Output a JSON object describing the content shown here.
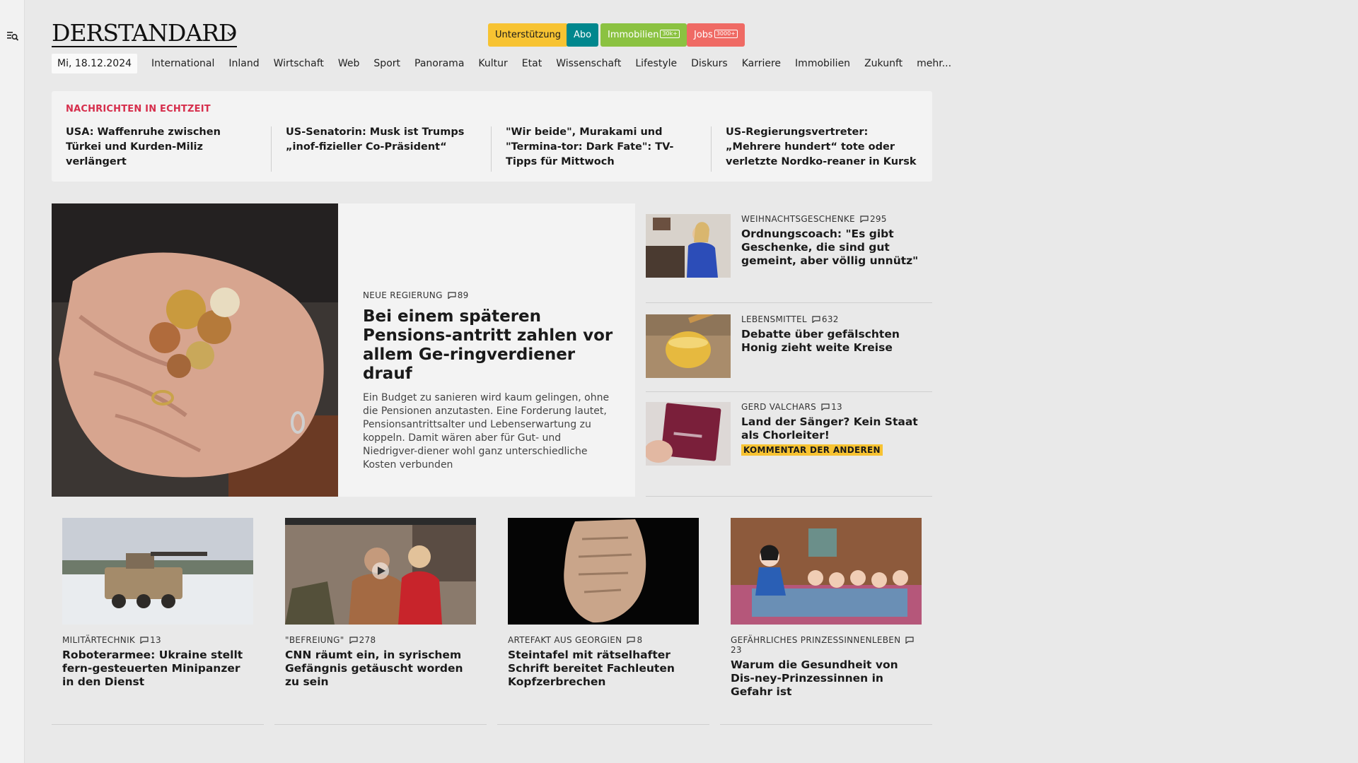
{
  "brand": {
    "logo_text": "DERSTANDARD"
  },
  "header_buttons": {
    "support": "Unterstützung",
    "abo": "Abo",
    "immobilien": "Immobilien",
    "immobilien_badge": "30k+",
    "jobs": "Jobs",
    "jobs_badge": "3000+"
  },
  "nav": {
    "date": "Mi, 18.12.2024",
    "items": [
      "International",
      "Inland",
      "Wirtschaft",
      "Web",
      "Sport",
      "Panorama",
      "Kultur",
      "Etat",
      "Wissenschaft",
      "Lifestyle",
      "Diskurs",
      "Karriere",
      "Immobilien",
      "Zukunft",
      "mehr..."
    ]
  },
  "ticker": {
    "heading": "NACHRICHTEN IN ECHTZEIT",
    "items": [
      "USA: Waffenruhe zwischen Türkei und Kurden-Miliz verlängert",
      "US-Senatorin: Musk ist Trumps „inof-fizieller Co-Präsident“",
      "\"Wir beide\", Murakami und \"Termina-tor: Dark Fate\": TV-Tipps für Mittwoch",
      "US-Regierungsvertreter: „Mehrere hundert“ tote oder verletzte Nordko-reaner in Kursk"
    ]
  },
  "lead": {
    "kicker": "NEUE REGIERUNG",
    "comments": "89",
    "title": "Bei einem späteren Pensions-antritt zahlen vor allem Ge-ringverdiener drauf",
    "teaser": "Ein Budget zu sanieren wird kaum gelingen, ohne die Pensionen anzutasten. Eine Forderung lautet, Pensionsantrittsalter und Lebenserwartung zu koppeln. Damit wären aber für Gut- und Niedrigver-diener wohl ganz unterschiedliche Kosten verbunden"
  },
  "side": [
    {
      "kicker": "WEIHNACHTSGESCHENKE",
      "comments": "295",
      "title": "Ordnungscoach: \"Es gibt Geschenke, die sind gut gemeint, aber völlig unnütz\""
    },
    {
      "kicker": "LEBENSMITTEL",
      "comments": "632",
      "title": "Debatte über gefälschten Honig zieht weite Kreise"
    },
    {
      "kicker": "GERD VALCHARS",
      "comments": "13",
      "title": "Land der Sänger? Kein Staat als Chorleiter!",
      "badge": "KOMMENTAR DER ANDEREN"
    }
  ],
  "cards": [
    {
      "kicker": "MILITÄRTECHNIK",
      "comments": "13",
      "title": "Roboterarmee: Ukraine stellt fern-gesteuerten Minipanzer in den Dienst"
    },
    {
      "kicker": "\"BEFREIUNG\"",
      "comments": "278",
      "title": "CNN räumt ein, in syrischem Gefängnis getäuscht worden zu sein"
    },
    {
      "kicker": "ARTEFAKT AUS GEORGIEN",
      "comments": "8",
      "title": "Steintafel mit rätselhafter Schrift bereitet Fachleuten Kopfzerbrechen"
    },
    {
      "kicker": "GEFÄHRLICHES PRINZESSINNENLEBEN",
      "comments": "23",
      "title": "Warum die Gesundheit von Dis-ney-Prinzessinnen in Gefahr ist"
    }
  ],
  "colors": {
    "accent_red": "#d62e4c",
    "support": "#f7c332",
    "abo": "#00878d",
    "immobilien": "#8bc241",
    "jobs": "#ef6a64"
  }
}
